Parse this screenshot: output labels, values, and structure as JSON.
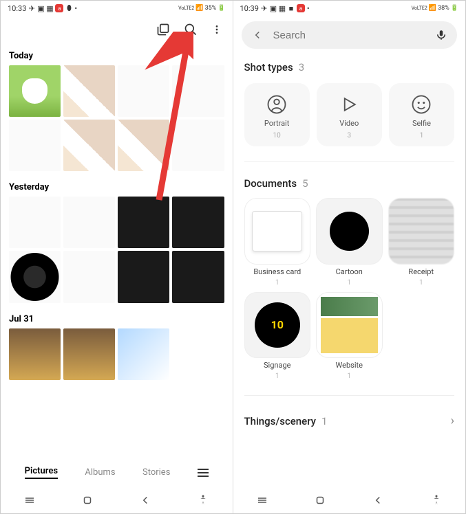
{
  "left": {
    "status": {
      "time": "10:33",
      "battery": "35%",
      "network": "VoLTE2"
    },
    "sections": [
      {
        "title": "Today",
        "thumbs": 8
      },
      {
        "title": "Yesterday",
        "thumbs": 8
      },
      {
        "title": "Jul 31",
        "thumbs": 3
      }
    ],
    "tabs": {
      "pictures": "Pictures",
      "albums": "Albums",
      "stories": "Stories"
    }
  },
  "right": {
    "status": {
      "time": "10:39",
      "battery": "38%",
      "network": "VoLTE2"
    },
    "search": {
      "placeholder": "Search"
    },
    "shot_types": {
      "title": "Shot types",
      "count": "3",
      "items": [
        {
          "label": "Portrait",
          "count": "10"
        },
        {
          "label": "Video",
          "count": "3"
        },
        {
          "label": "Selfie",
          "count": "1"
        }
      ]
    },
    "documents": {
      "title": "Documents",
      "count": "5",
      "items": [
        {
          "label": "Business card",
          "count": "1"
        },
        {
          "label": "Cartoon",
          "count": "1"
        },
        {
          "label": "Receipt",
          "count": "1"
        },
        {
          "label": "Signage",
          "count": "1"
        },
        {
          "label": "Website",
          "count": "1"
        }
      ]
    },
    "things": {
      "title": "Things/scenery",
      "count": "1"
    }
  }
}
